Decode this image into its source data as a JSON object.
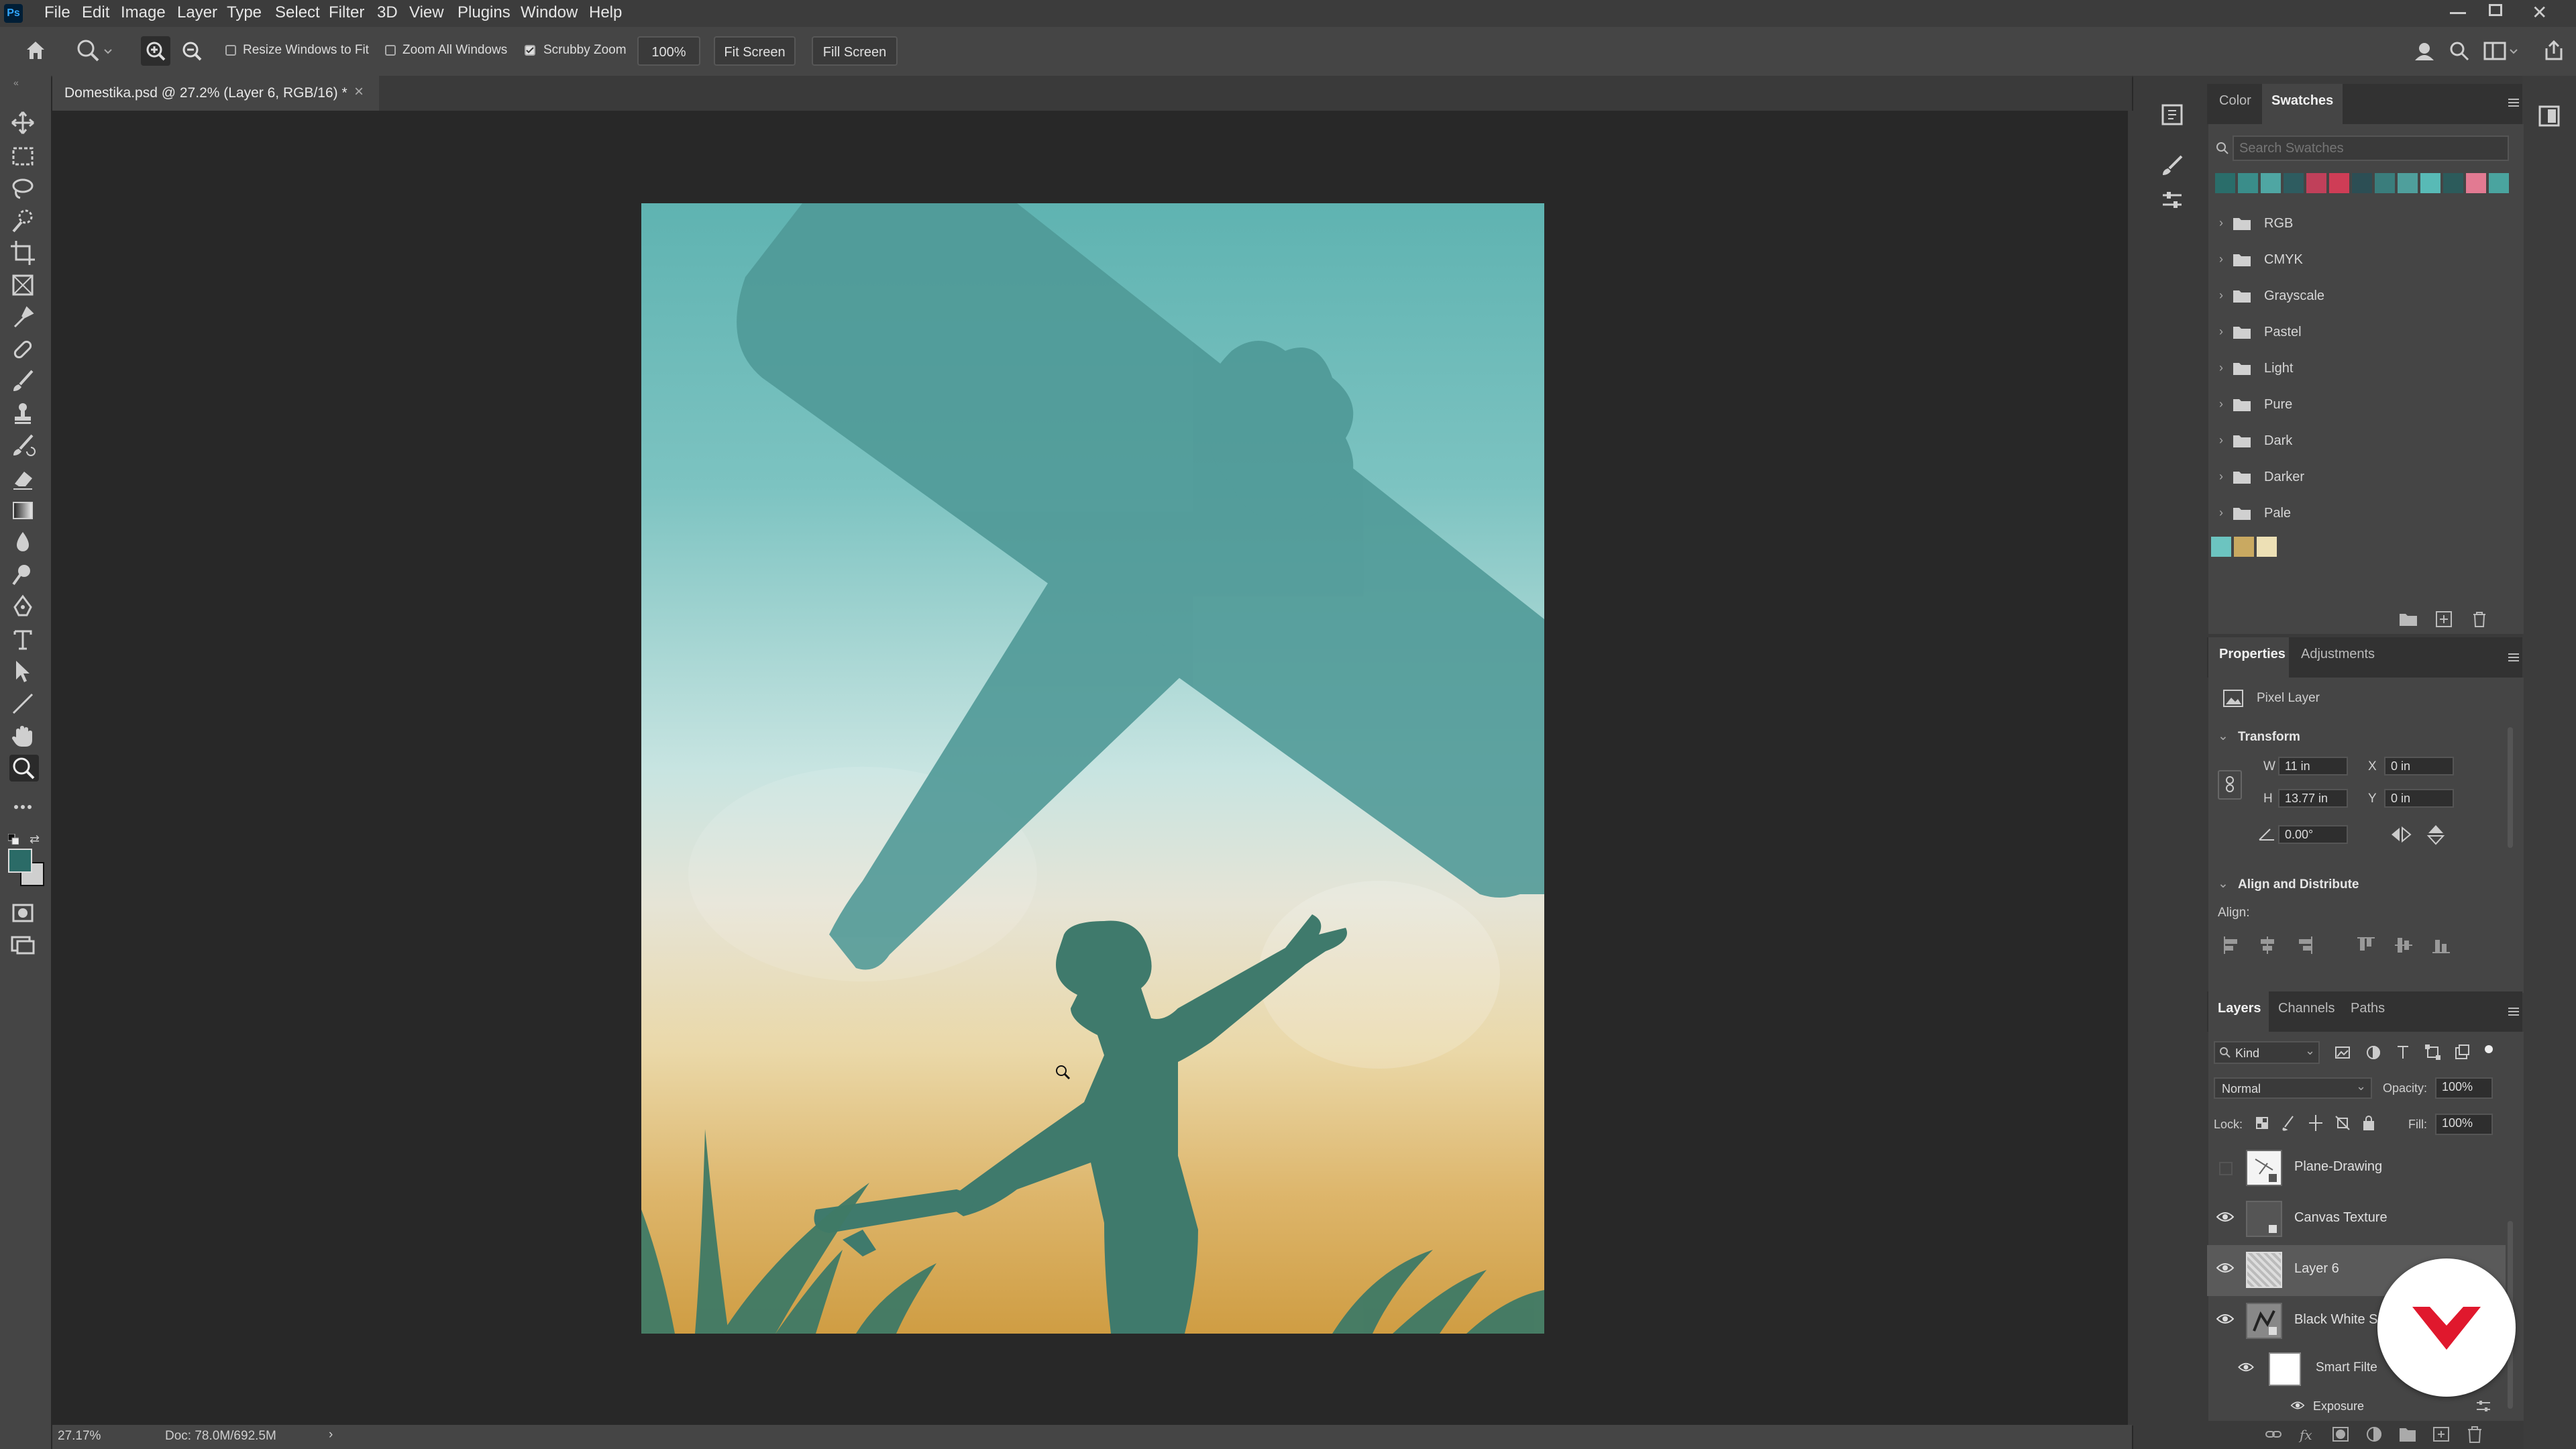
{
  "menubar": {
    "items": [
      "File",
      "Edit",
      "Image",
      "Layer",
      "Type",
      "Select",
      "Filter",
      "3D",
      "View",
      "Plugins",
      "Window",
      "Help"
    ]
  },
  "options": {
    "resize_windows_label": "Resize Windows to Fit",
    "zoom_all_label": "Zoom All Windows",
    "scrubby_label": "Scrubby Zoom",
    "zoom_value": "100%",
    "fit_screen": "Fit Screen",
    "fill_screen": "Fill Screen"
  },
  "document": {
    "tab_title": "Domestika.psd @ 27.2% (Layer 6, RGB/16) *",
    "close": "×"
  },
  "status": {
    "zoom": "27.17%",
    "doc_size": "Doc: 78.0M/692.5M",
    "arrow": "›"
  },
  "swatches_panel": {
    "tabs": [
      "Color",
      "Swatches"
    ],
    "search_placeholder": "Search Swatches",
    "folders": [
      "RGB",
      "CMYK",
      "Grayscale",
      "Pastel",
      "Light",
      "Pure",
      "Dark",
      "Darker",
      "Pale"
    ],
    "recent_colors": [
      "#2a6d6a",
      "#3a8d8a",
      "#4fa6a3",
      "#2e5c60",
      "#c0405a",
      "#cf3d56",
      "#2c4e54",
      "#3a7d7c",
      "#4f9f9c",
      "#58bab6",
      "#2c5b5b",
      "#e27a92",
      "#4aa49f"
    ],
    "custom_colors": [
      "#6cc4c0",
      "#c9a961",
      "#ede0b5"
    ]
  },
  "properties_panel": {
    "tabs": [
      "Properties",
      "Adjustments"
    ],
    "layer_type": "Pixel Layer",
    "transform_title": "Transform",
    "w_label": "W",
    "w_value": "11 in",
    "h_label": "H",
    "h_value": "13.77 in",
    "x_label": "X",
    "x_value": "0 in",
    "y_label": "Y",
    "y_value": "0 in",
    "angle_value": "0.00°",
    "align_title": "Align and Distribute",
    "align_label": "Align:"
  },
  "layers_panel": {
    "tabs": [
      "Layers",
      "Channels",
      "Paths"
    ],
    "filter_kind": "Kind",
    "blend_mode": "Normal",
    "opacity_label": "Opacity:",
    "opacity_value": "100%",
    "lock_label": "Lock:",
    "fill_label": "Fill:",
    "fill_value": "100%",
    "layers": [
      {
        "name": "Plane-Drawing",
        "visible": false
      },
      {
        "name": "Canvas Texture",
        "visible": true
      },
      {
        "name": "Layer 6",
        "visible": true,
        "selected": true
      },
      {
        "name": "Black White Sc",
        "visible": true
      }
    ],
    "smart_filters_label": "Smart Filte",
    "exposure_label": "Exposure"
  },
  "colors": {
    "accent": "#1473e6",
    "foreground": "#2b6b67",
    "background": "#cfcfcf",
    "domestika_red": "#e0182d"
  }
}
